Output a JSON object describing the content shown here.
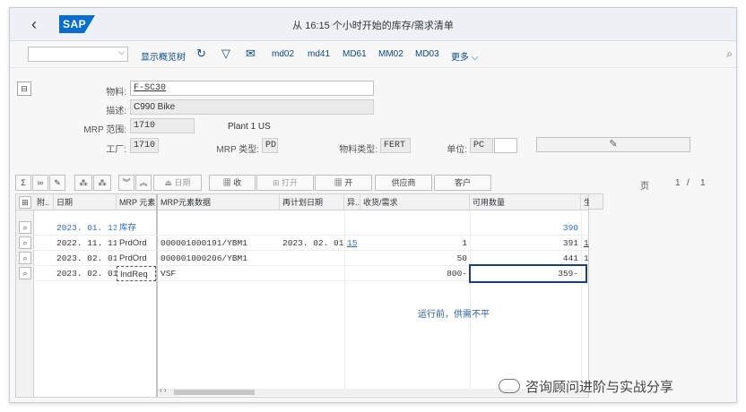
{
  "window": {
    "title": "从 16:15 个小时开始的库存/需求清单"
  },
  "toolbar": {
    "variant_value": "",
    "show_overview": "显示概览树",
    "buttons": [
      "md02",
      "md41",
      "MD61",
      "MM02",
      "MD03"
    ],
    "more": "更多"
  },
  "header": {
    "material_label": "物料:",
    "material_value": "F-SC30",
    "desc_label": "描述:",
    "desc_value": "C990 Bike",
    "mrp_area_label": "MRP 范围:",
    "mrp_area_value": "1710",
    "mrp_area_text": "Plant 1 US",
    "plant_label": "工厂:",
    "plant_value": "1710",
    "mrp_type_label": "MRP 类型:",
    "mrp_type_value": "PD",
    "mat_type_label": "物料类型:",
    "mat_type_value": "FERT",
    "unit_label": "单位:",
    "unit_value": "PC"
  },
  "grid_toolbar": {
    "date_label": "日期",
    "receipt_label": "收",
    "open_label": "打开",
    "open2_label": "开",
    "vendor_label": "供应商",
    "customer_label": "客户",
    "page_label": "页",
    "page_current": "1",
    "page_sep": "/",
    "page_total": "1"
  },
  "grid": {
    "columns": [
      "附..",
      "日期",
      "MRP 元素",
      "MRP元素数据",
      "再计划日期",
      "异..",
      "收货/需求",
      "可用数量",
      "生"
    ],
    "rows": [
      {
        "date": "2023. 01. 13",
        "element": "库存",
        "data": "",
        "resched": "",
        "exc": "",
        "qty": "",
        "avail": "390",
        "extra": ""
      },
      {
        "date": "2022. 11. 11",
        "element": "PrdOrd",
        "data": "000001000191/YBM1",
        "resched": "2023. 02. 01",
        "exc": "15",
        "qty": "1",
        "avail": "391",
        "extra": "1"
      },
      {
        "date": "2023. 02. 01",
        "element": "PrdOrd",
        "data": "000001000206/YBM1",
        "resched": "",
        "exc": "",
        "qty": "50",
        "avail": "441",
        "extra": "1"
      },
      {
        "date": "2023. 02. 01",
        "element": "IndReq",
        "data": "VSF",
        "resched": "",
        "exc": "",
        "qty": "800-",
        "avail": "359-",
        "extra": ""
      }
    ],
    "message": "运行前，供需不平"
  },
  "watermark": "咨询顾问进阶与实战分享"
}
